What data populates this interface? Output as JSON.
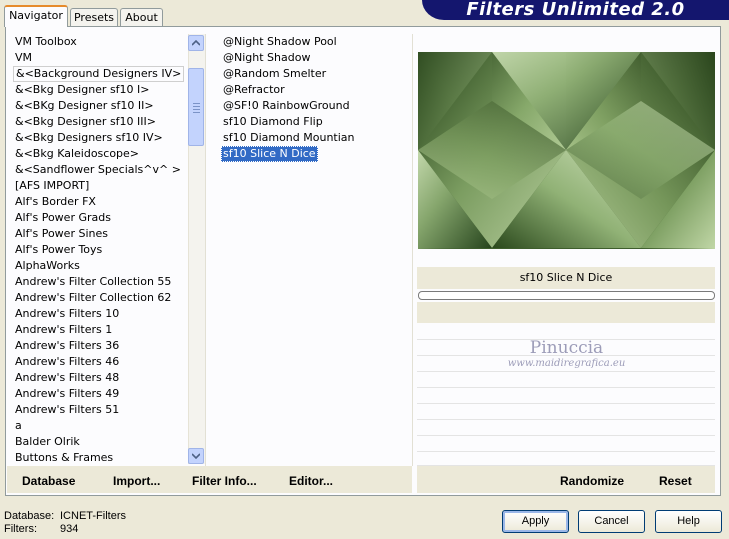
{
  "tabs": [
    {
      "label": "Navigator",
      "active": true
    },
    {
      "label": "Presets",
      "active": false
    },
    {
      "label": "About",
      "active": false
    }
  ],
  "banner": {
    "title": "Filters Unlimited 2.0"
  },
  "categories": [
    {
      "label": "VM Toolbox"
    },
    {
      "label": "VM"
    },
    {
      "label": "&<Background Designers IV>",
      "framed": true
    },
    {
      "label": "&<Bkg Designer sf10 I>"
    },
    {
      "label": "&<BKg Designer sf10 II>"
    },
    {
      "label": "&<Bkg Designer sf10 III>"
    },
    {
      "label": "&<Bkg Designers sf10 IV>"
    },
    {
      "label": "&<Bkg Kaleidoscope>"
    },
    {
      "label": "&<Sandflower Specials^v^ >"
    },
    {
      "label": "[AFS IMPORT]"
    },
    {
      "label": "Alf's Border FX"
    },
    {
      "label": "Alf's Power Grads"
    },
    {
      "label": "Alf's Power Sines"
    },
    {
      "label": "Alf's Power Toys"
    },
    {
      "label": "AlphaWorks"
    },
    {
      "label": "Andrew's Filter Collection 55"
    },
    {
      "label": "Andrew's Filter Collection 62"
    },
    {
      "label": "Andrew's Filters 10"
    },
    {
      "label": "Andrew's Filters 1"
    },
    {
      "label": "Andrew's Filters 36"
    },
    {
      "label": "Andrew's Filters 46"
    },
    {
      "label": "Andrew's Filters 48"
    },
    {
      "label": "Andrew's Filters 49"
    },
    {
      "label": "Andrew's Filters 51"
    },
    {
      "label": "a"
    },
    {
      "label": "Balder Olrik"
    },
    {
      "label": "Buttons & Frames"
    }
  ],
  "filters": [
    {
      "label": "@Night Shadow Pool"
    },
    {
      "label": "@Night Shadow"
    },
    {
      "label": "@Random Smelter"
    },
    {
      "label": "@Refractor"
    },
    {
      "label": "@SF!0 RainbowGround"
    },
    {
      "label": "sf10 Diamond Flip"
    },
    {
      "label": "sf10 Diamond Mountian"
    },
    {
      "label": "sf10 Slice N Dice",
      "selected": true
    }
  ],
  "scrollbar": {
    "up_icon": "arrow-up-icon",
    "down_icon": "arrow-down-icon"
  },
  "left_actions": {
    "database": "Database",
    "import": "Import...",
    "filter_info": "Filter Info...",
    "editor": "Editor..."
  },
  "right_actions": {
    "randomize": "Randomize",
    "reset": "Reset"
  },
  "preview": {
    "filter_name": "sf10 Slice N Dice"
  },
  "watermark": {
    "line1": "Pinuccia",
    "line2": "www.maidiregrafica.eu"
  },
  "dialog_buttons": {
    "apply": "Apply",
    "cancel": "Cancel",
    "help": "Help"
  },
  "status": {
    "database_label": "Database:",
    "database_value": "ICNET-Filters",
    "filters_label": "Filters:",
    "filters_value": "934"
  },
  "colors": {
    "dialog_bg": "#ece9d8",
    "banner_bg": "#14166e",
    "selection": "#316ac5",
    "preview_dark": "#2c4a1c",
    "preview_light": "#b8d49c"
  }
}
